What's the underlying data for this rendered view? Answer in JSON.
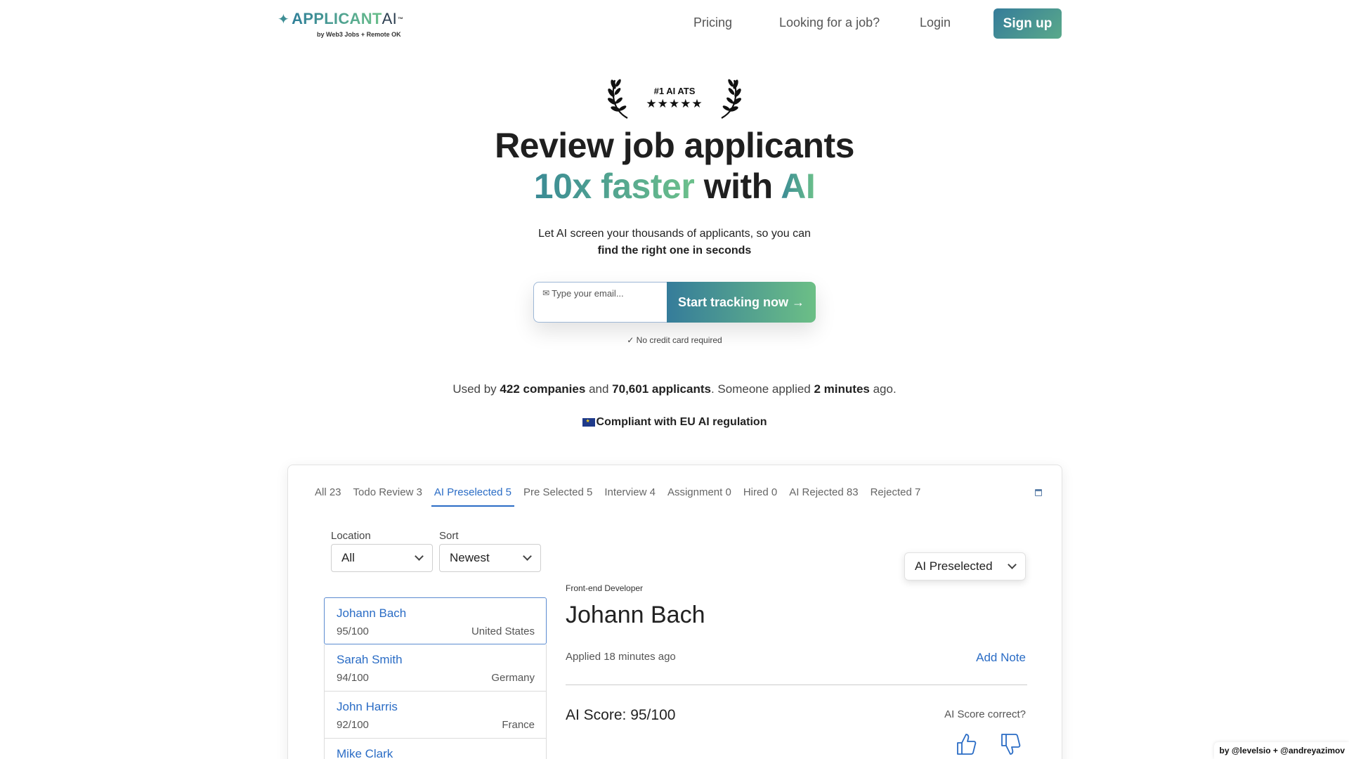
{
  "nav": {
    "logo_word": "APPLICANT",
    "logo_ai": "AI",
    "logo_tm": "™",
    "logo_sub": "by Web3 Jobs + Remote OK",
    "links": [
      "Pricing",
      "Looking for a job?",
      "Login"
    ],
    "signup": "Sign up"
  },
  "badge": {
    "label": "#1 AI ATS",
    "stars": "★★★★★"
  },
  "hero": {
    "line1": "Review job applicants",
    "line2_accent": "10x faster",
    "line2_mid": "with",
    "line2_ai": "AI",
    "sub1": "Let AI screen your thousands of applicants, so you can",
    "sub2": "find the right one in seconds"
  },
  "cta": {
    "email_placeholder": "Type your email...",
    "button": "Start tracking now →",
    "note": "✓ No credit card required"
  },
  "stats": {
    "pre": "Used by",
    "companies": "422 companies",
    "and": "and",
    "applicants": "70,601 applicants",
    "mid": ". Someone applied",
    "time": "2 minutes",
    "post": "ago."
  },
  "eu": "Compliant with EU AI regulation",
  "demo": {
    "tabs": [
      "All 23",
      "Todo Review 3",
      "AI Preselected 5",
      "Pre Selected 5",
      "Interview 4",
      "Assignment 0",
      "Hired 0",
      "AI Rejected 83",
      "Rejected 7"
    ],
    "active_tab": 2,
    "filters": {
      "location_label": "Location",
      "location_value": "All",
      "sort_label": "Sort",
      "sort_value": "Newest"
    },
    "status_value": "AI Preselected",
    "applicants": [
      {
        "name": "Johann Bach",
        "score": "95/100",
        "country": "United States"
      },
      {
        "name": "Sarah Smith",
        "score": "94/100",
        "country": "Germany"
      },
      {
        "name": "John Harris",
        "score": "92/100",
        "country": "France"
      },
      {
        "name": "Mike Clark",
        "score": "",
        "country": ""
      }
    ],
    "detail": {
      "role": "Front-end Developer",
      "name": "Johann Bach",
      "applied": "Applied 18 minutes ago",
      "add_note": "Add Note",
      "score": "AI Score: 95/100",
      "correct_q": "AI Score correct?"
    }
  },
  "credit": "by @levelsio + @andreyazimov",
  "colors": {
    "brand_start": "#357c9a",
    "brand_end": "#6cbf86",
    "link_blue": "#2a6cc5"
  }
}
